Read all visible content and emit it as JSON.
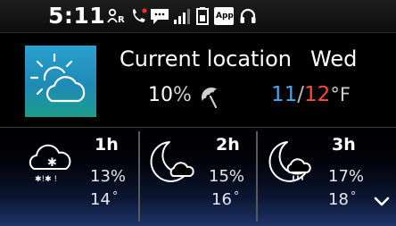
{
  "status_bar": {
    "time": "5:11",
    "icons": [
      "roaming-icon",
      "missed-call-icon",
      "message-icon",
      "signal-icon",
      "battery-icon",
      "app-notification-icon",
      "headset-icon"
    ],
    "app_badge": "App"
  },
  "current": {
    "icon": "sun-behind-cloud-icon",
    "location": "Current location",
    "day": "Wed",
    "precip_value": "10",
    "precip_unit": "%",
    "temp_low": "11",
    "temp_sep": "/",
    "temp_high": "12",
    "temp_unit": "°F",
    "colors": {
      "low": "#46a6ee",
      "high": "#ff4b3a",
      "tile": "#2aa0cf"
    }
  },
  "forecast": [
    {
      "label": "1h",
      "icon": "snow-cloud-icon",
      "precip": "13%",
      "temp": "14",
      "degree": "°"
    },
    {
      "label": "2h",
      "icon": "moon-cloud-icon",
      "precip": "15%",
      "temp": "16",
      "degree": "°"
    },
    {
      "label": "3h",
      "icon": "moon-rain-cloud-icon",
      "precip": "17%",
      "temp": "18",
      "degree": "°"
    }
  ],
  "more_icon": "chevron-down-icon"
}
